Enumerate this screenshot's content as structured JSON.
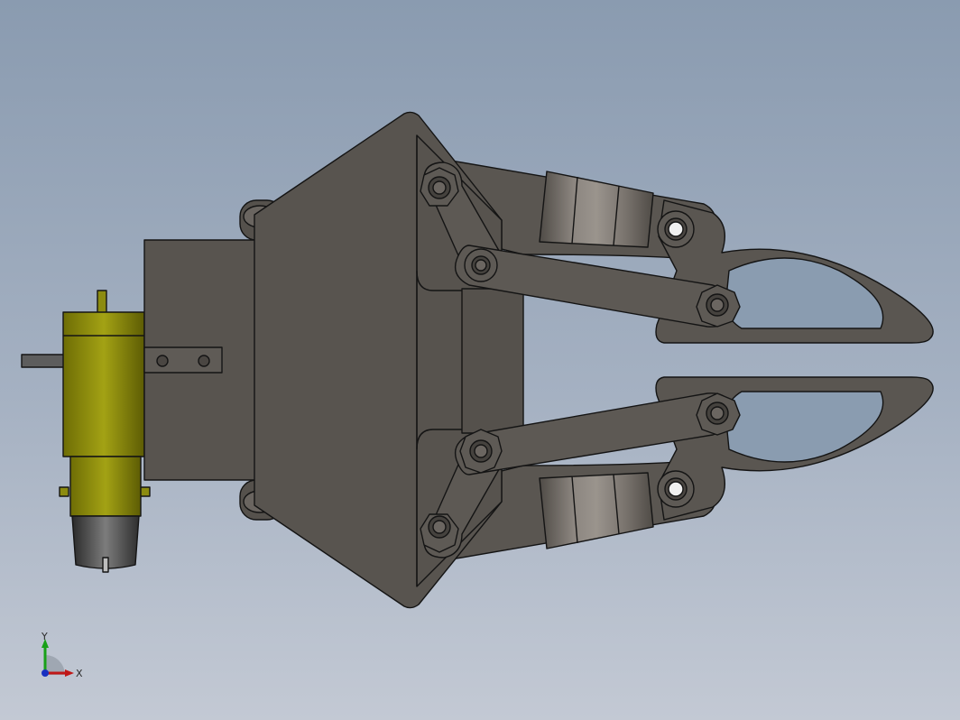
{
  "viewport": {
    "model": "gripper-assembly",
    "colors": {
      "background_top": "#8a9bb0",
      "background_bottom": "#c3c9d4",
      "body": "#58544f",
      "finger": "#5a5651",
      "link": "#5d5954",
      "motor": "#8c8b10",
      "motor_dark": "#5b5a06",
      "edge": "#141414"
    }
  },
  "triad": {
    "x_label": "X",
    "y_label": "Y",
    "x_color": "#c01818",
    "y_color": "#18a018",
    "z_color": "#1830c0"
  }
}
